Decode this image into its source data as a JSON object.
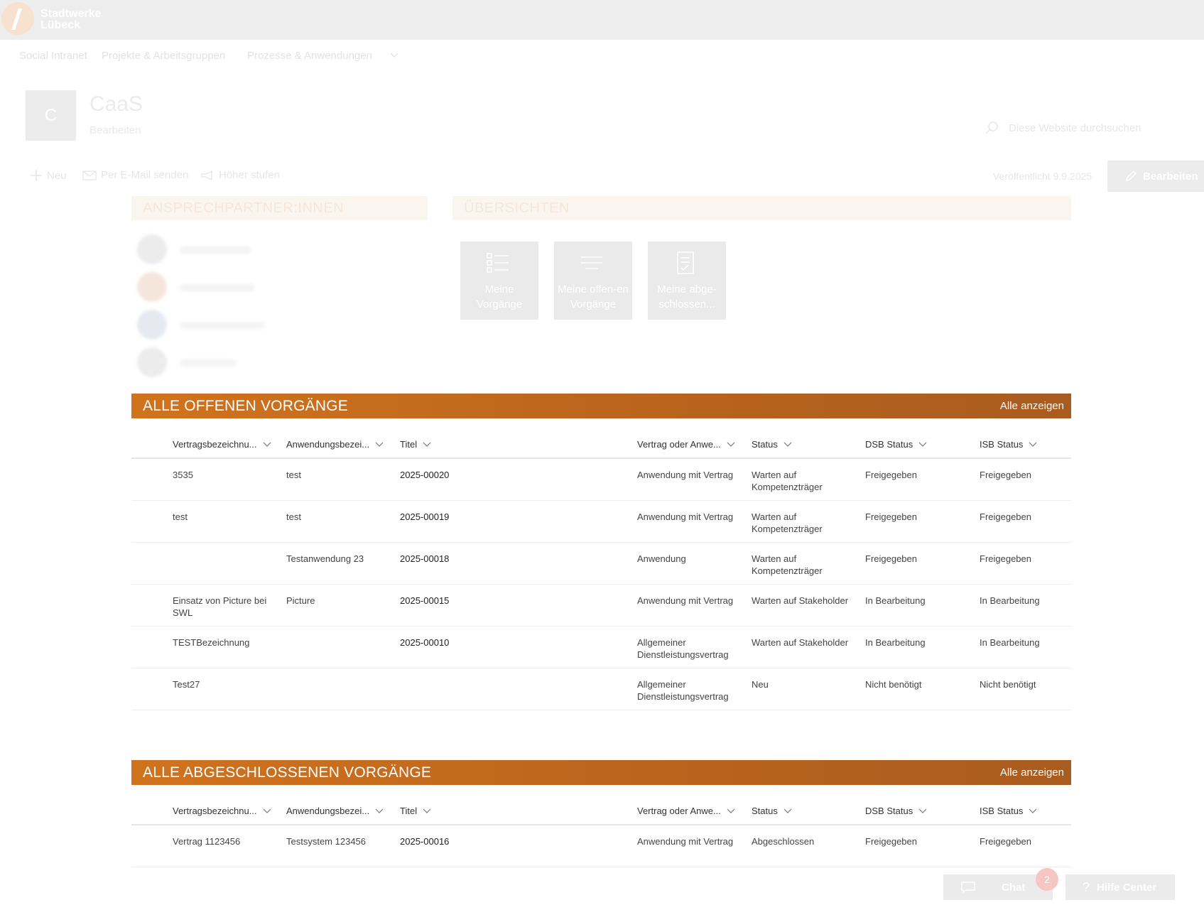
{
  "brand": {
    "name": "Stadtwerke\nLübeck"
  },
  "hubnav": {
    "items": [
      "Social Intranet",
      "Projekte & Arbeitsgruppen",
      "Prozesse & Anwendungen"
    ]
  },
  "site": {
    "logo_letter": "C",
    "title": "CaaS",
    "subtitle": "Bearbeiten",
    "search_placeholder": "Diese Website durchsuchen"
  },
  "commandbar": {
    "new_label": "Neu",
    "email_label": "Per E-Mail senden",
    "promote_label": "Höher stufen",
    "published": "Veröffentlicht 9.9.2025",
    "edit_label": "Bearbeiten"
  },
  "contacts": {
    "title": "ANSPRECHPARTNER:INNEN"
  },
  "overviews": {
    "title": "ÜBERSICHTEN",
    "tiles": [
      {
        "label": "Meine Vorgänge",
        "icon": "checklist-icon"
      },
      {
        "label": "Meine offen-en Vorgänge",
        "icon": "lines-icon"
      },
      {
        "label": "Meine abge-schlossen...",
        "icon": "document-check-icon"
      }
    ]
  },
  "columns": [
    "Vertragsbezeichnu...",
    "Anwendungsbezei...",
    "Titel",
    "Vertrag oder Anwe...",
    "Status",
    "DSB Status",
    "ISB Status"
  ],
  "open_list": {
    "title": "ALLE OFFENEN VORGÄNGE",
    "show_all": "Alle anzeigen",
    "rows": [
      {
        "vertrag": "3535",
        "anwendung": "test",
        "titel": "2025-00020",
        "typ": "Anwendung mit Vertrag",
        "status": "Warten auf Kompetenzträger",
        "dsb": "Freigegeben",
        "isb": "Freigegeben"
      },
      {
        "vertrag": "test",
        "anwendung": "test",
        "titel": "2025-00019",
        "typ": "Anwendung mit Vertrag",
        "status": "Warten auf Kompetenzträger",
        "dsb": "Freigegeben",
        "isb": "Freigegeben"
      },
      {
        "vertrag": "",
        "anwendung": "Testanwendung 23",
        "titel": "2025-00018",
        "typ": "Anwendung",
        "status": "Warten auf Kompetenzträger",
        "dsb": "Freigegeben",
        "isb": "Freigegeben"
      },
      {
        "vertrag": "Einsatz von Picture bei SWL",
        "anwendung": "Picture",
        "titel": "2025-00015",
        "typ": "Anwendung mit Vertrag",
        "status": "Warten auf Stakeholder",
        "dsb": "In Bearbeitung",
        "isb": "In Bearbeitung"
      },
      {
        "vertrag": "TESTBezeichnung",
        "anwendung": "",
        "titel": "2025-00010",
        "typ": "Allgemeiner Dienstleistungsvertrag",
        "status": "Warten auf Stakeholder",
        "dsb": "In Bearbeitung",
        "isb": "In Bearbeitung"
      },
      {
        "vertrag": "Test27",
        "anwendung": "",
        "titel": "",
        "typ": "Allgemeiner Dienstleistungsvertrag",
        "status": "Neu",
        "dsb": "Nicht benötigt",
        "isb": "Nicht benötigt"
      }
    ]
  },
  "closed_list": {
    "title": "ALLE ABGESCHLOSSENEN VORGÄNGE",
    "show_all": "Alle anzeigen",
    "rows": [
      {
        "vertrag": "Vertrag 1123456",
        "anwendung": "Testsystem 123456",
        "titel": "2025-00016",
        "typ": "Anwendung mit Vertrag",
        "status": "Abgeschlossen",
        "dsb": "Freigegeben",
        "isb": "Freigegeben"
      }
    ]
  },
  "floating": {
    "chat_label": "Chat",
    "chat_badge": "2",
    "help_label": "Hilfe Center"
  },
  "colors": {
    "accent": "#c46a1c",
    "header_gradient_end": "#a95c1f"
  }
}
